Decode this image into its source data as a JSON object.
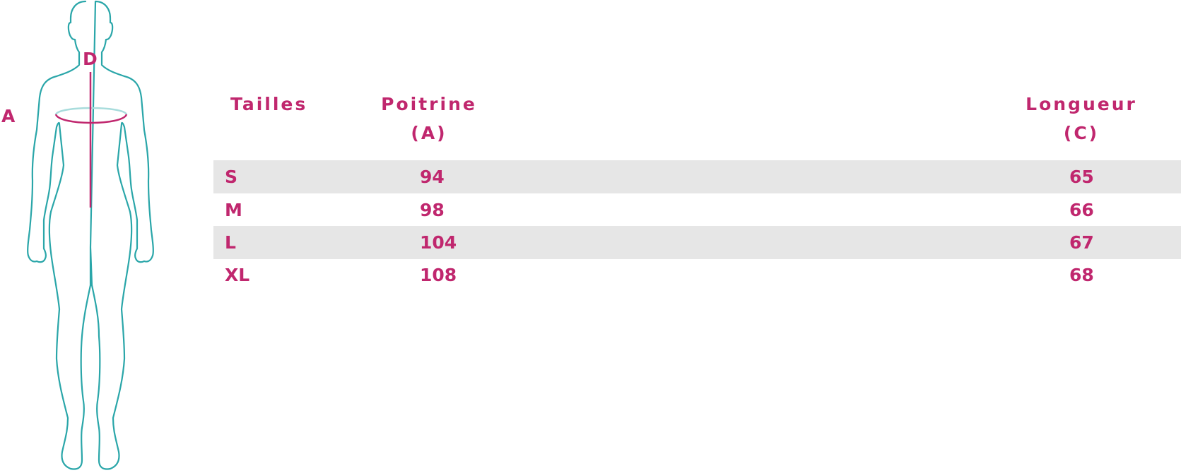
{
  "figure": {
    "label_a": "A",
    "label_d": "D",
    "colors": {
      "outline": "#2aa6a9",
      "accent": "#c0276e",
      "chest_back": "#a8dcdc"
    }
  },
  "table": {
    "headers": {
      "size": "Tailles",
      "chest": "Poitrine (A)",
      "length": "Longueur (C)"
    },
    "rows": [
      {
        "size": "S",
        "chest": "94",
        "length": "65"
      },
      {
        "size": "M",
        "chest": "98",
        "length": "66"
      },
      {
        "size": "L",
        "chest": "104",
        "length": "67"
      },
      {
        "size": "XL",
        "chest": "108",
        "length": "68"
      }
    ],
    "colors": {
      "text": "#c0276e",
      "row_shade": "#e6e6e6"
    }
  }
}
